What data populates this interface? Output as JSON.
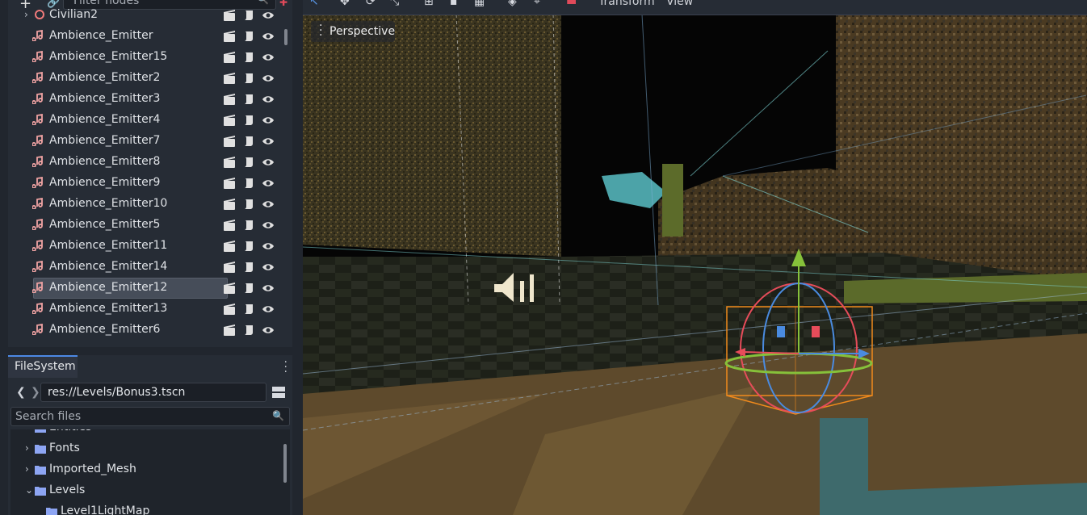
{
  "scene_dock": {
    "filter_placeholder": "Filter nodes",
    "nodes": [
      {
        "label": "Civilian2",
        "type": "civilian"
      },
      {
        "label": "Ambience_Emitter",
        "type": "audio"
      },
      {
        "label": "Ambience_Emitter15",
        "type": "audio"
      },
      {
        "label": "Ambience_Emitter2",
        "type": "audio"
      },
      {
        "label": "Ambience_Emitter3",
        "type": "audio"
      },
      {
        "label": "Ambience_Emitter4",
        "type": "audio"
      },
      {
        "label": "Ambience_Emitter7",
        "type": "audio"
      },
      {
        "label": "Ambience_Emitter8",
        "type": "audio"
      },
      {
        "label": "Ambience_Emitter9",
        "type": "audio"
      },
      {
        "label": "Ambience_Emitter10",
        "type": "audio"
      },
      {
        "label": "Ambience_Emitter5",
        "type": "audio"
      },
      {
        "label": "Ambience_Emitter11",
        "type": "audio"
      },
      {
        "label": "Ambience_Emitter14",
        "type": "audio"
      },
      {
        "label": "Ambience_Emitter12",
        "type": "audio",
        "selected": true
      },
      {
        "label": "Ambience_Emitter13",
        "type": "audio"
      },
      {
        "label": "Ambience_Emitter6",
        "type": "audio"
      }
    ]
  },
  "filesystem": {
    "tab_label": "FileSystem",
    "path": "res://Levels/Bonus3.tscn",
    "search_placeholder": "Search files",
    "items": [
      {
        "label": "Entities",
        "expanded": false,
        "depth": 1
      },
      {
        "label": "Fonts",
        "expanded": false,
        "depth": 1
      },
      {
        "label": "Imported_Mesh",
        "expanded": false,
        "depth": 1
      },
      {
        "label": "Levels",
        "expanded": true,
        "depth": 1
      },
      {
        "label": "Level1LightMap",
        "expanded": false,
        "depth": 2
      }
    ]
  },
  "viewport": {
    "menus": {
      "transform": "Transform",
      "view": "View"
    },
    "perspective_label": "Perspective"
  },
  "colors": {
    "accent": "#4c88e4",
    "audio_icon": "#f0a3a3",
    "folder": "#8da5f3",
    "gizmo_x": "#e74c5a",
    "gizmo_y": "#86c13a",
    "gizmo_z": "#4a8be0",
    "selection_box": "#f08a1c"
  }
}
